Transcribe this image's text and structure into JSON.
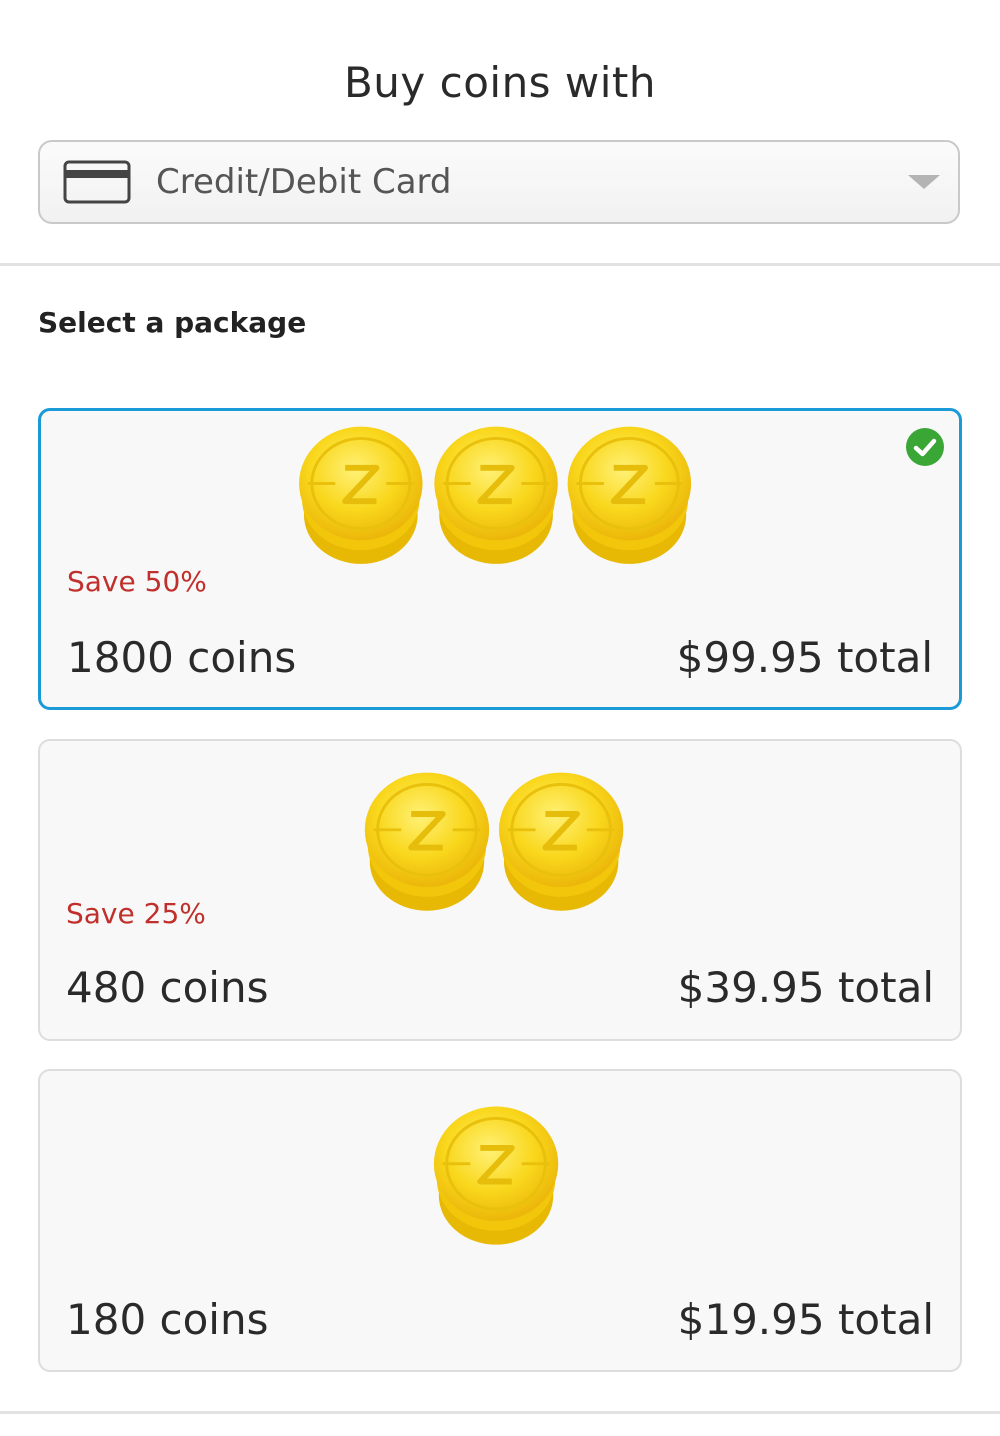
{
  "header": {
    "title": "Buy coins with"
  },
  "payment_method": {
    "selected_label": "Credit/Debit Card",
    "icon": "credit-card-icon"
  },
  "packages_section": {
    "label": "Select a package"
  },
  "packages": [
    {
      "save_label": "Save 50%",
      "coins_label": "1800 coins",
      "price_label": "$99.95 total",
      "selected": true,
      "coin_stacks": 3
    },
    {
      "save_label": "Save 25%",
      "coins_label": "480 coins",
      "price_label": "$39.95 total",
      "selected": false,
      "coin_stacks": 2
    },
    {
      "save_label": "",
      "coins_label": "180 coins",
      "price_label": "$19.95 total",
      "selected": false,
      "coin_stacks": 1
    }
  ],
  "colors": {
    "selected_border": "#1a9ad6",
    "save_text": "#c0302c",
    "check_green": "#3aa636",
    "coin_gold": "#f5cf0c"
  }
}
